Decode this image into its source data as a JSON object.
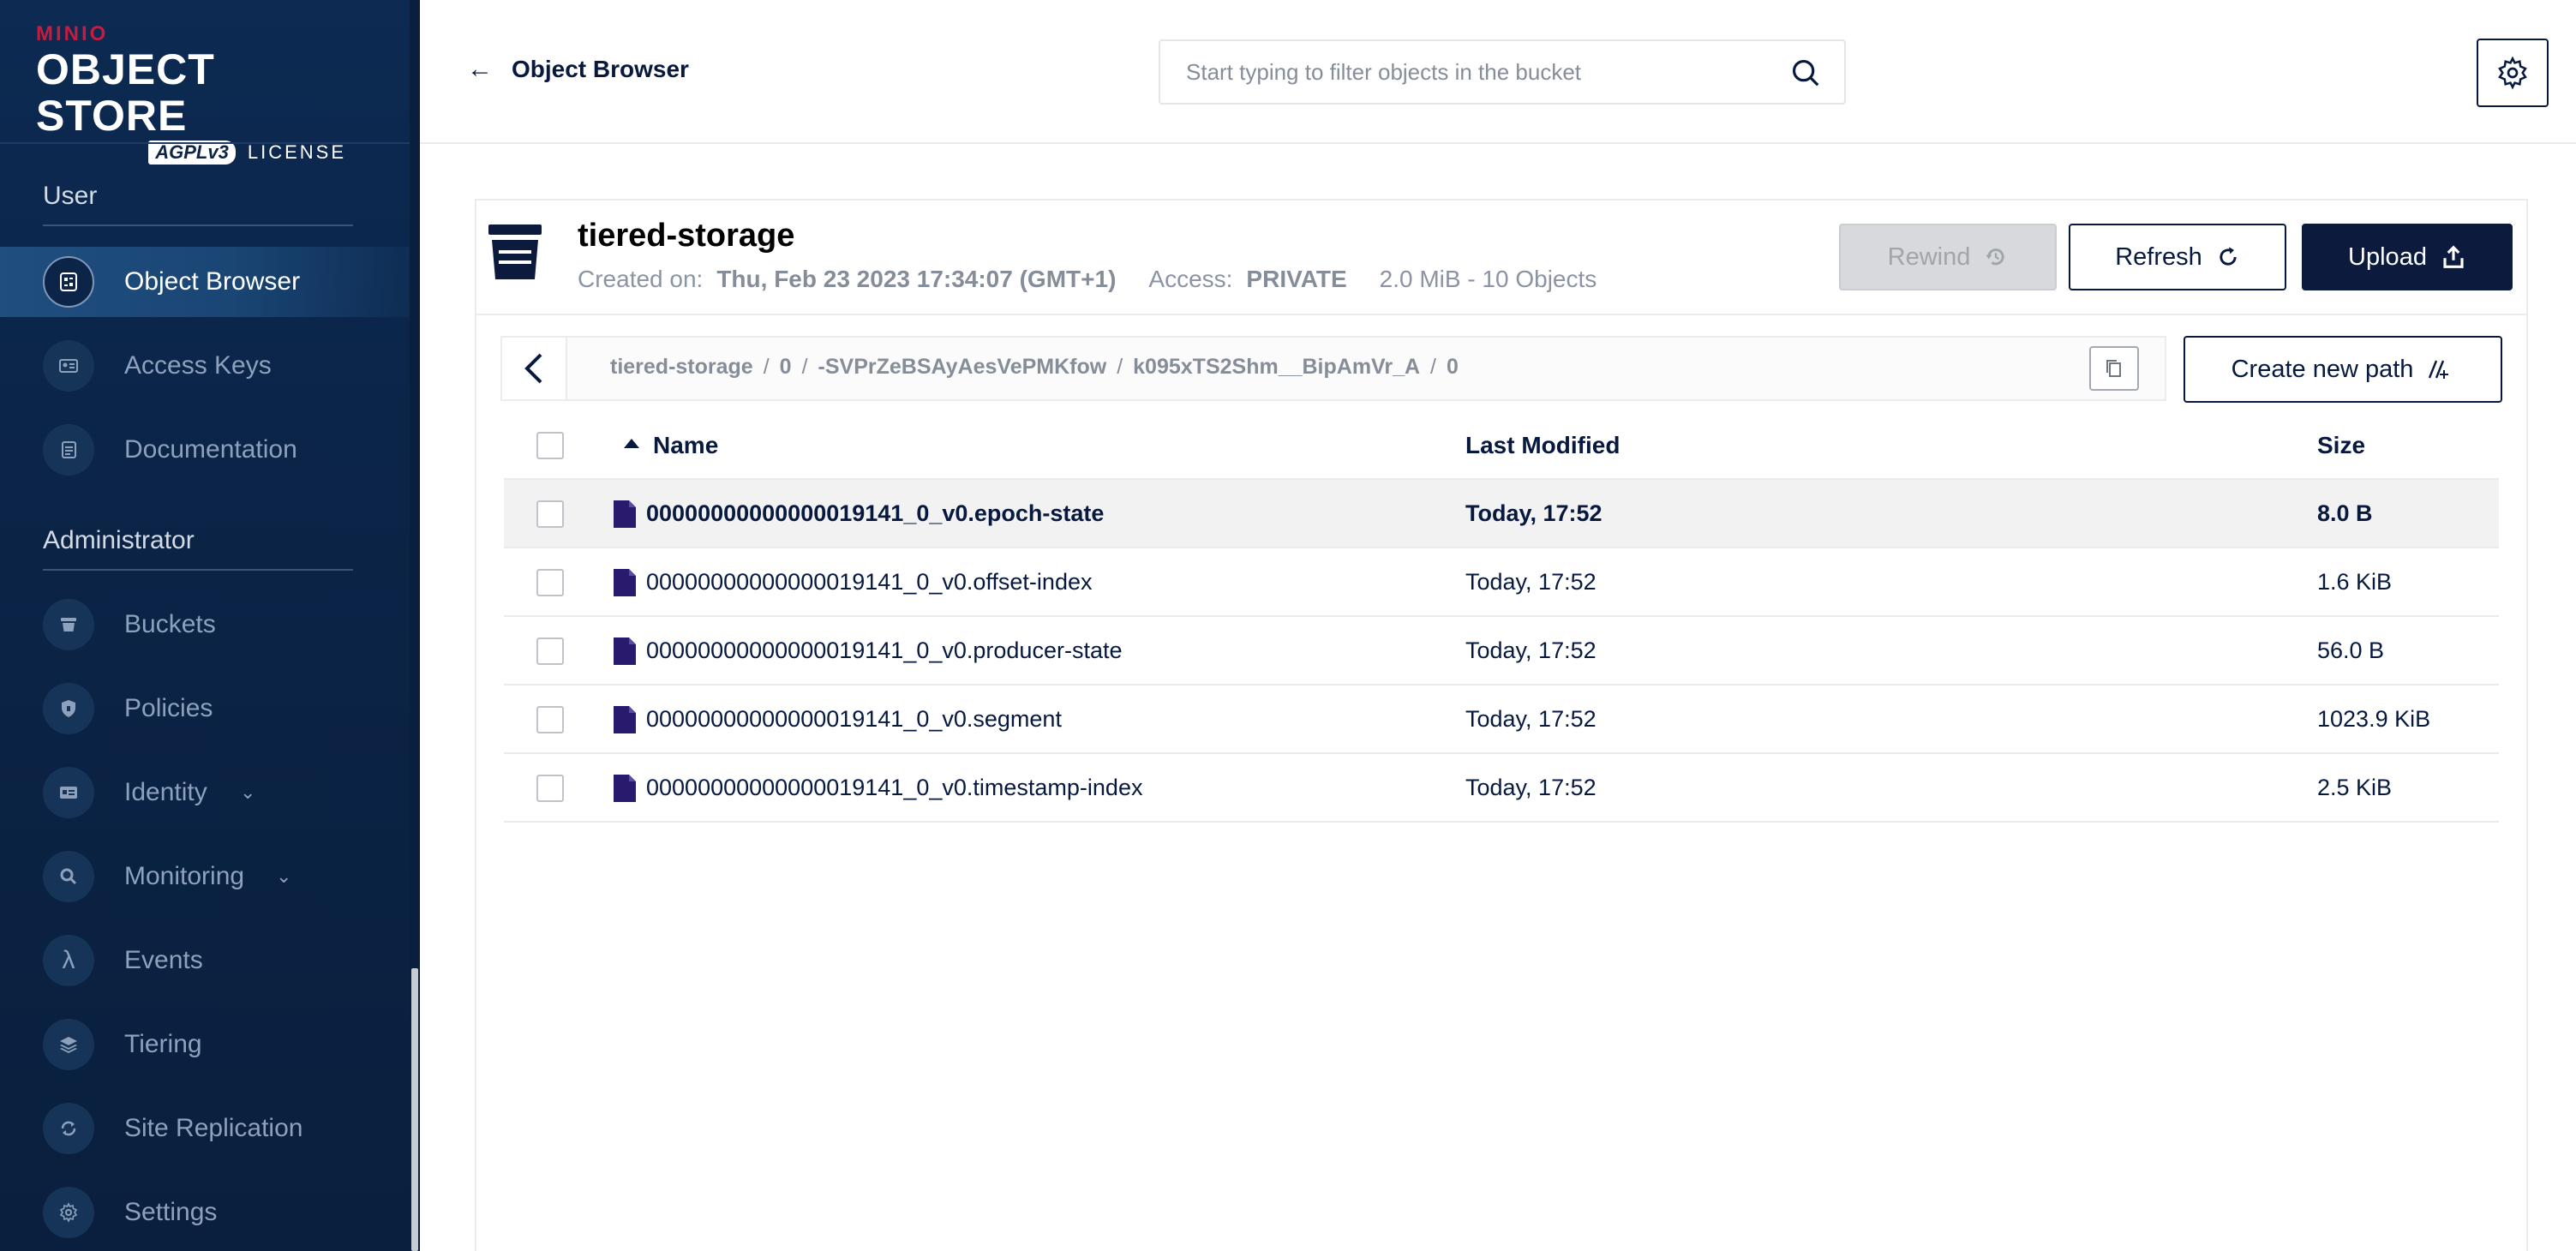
{
  "brand": {
    "minio": "MINIO",
    "title": "OBJECT STORE",
    "agpl": "AGPLv3",
    "license": "LICENSE"
  },
  "sidebar": {
    "user_section": "User",
    "admin_section": "Administrator",
    "user_items": [
      {
        "label": "Object Browser",
        "icon": "object-browser-icon",
        "active": true
      },
      {
        "label": "Access Keys",
        "icon": "access-keys-icon"
      },
      {
        "label": "Documentation",
        "icon": "documentation-icon"
      }
    ],
    "admin_items": [
      {
        "label": "Buckets",
        "icon": "bucket-icon"
      },
      {
        "label": "Policies",
        "icon": "shield-icon"
      },
      {
        "label": "Identity",
        "icon": "id-card-icon",
        "expandable": true
      },
      {
        "label": "Monitoring",
        "icon": "magnifier-icon",
        "expandable": true
      },
      {
        "label": "Events",
        "icon": "lambda-icon",
        "glyph": "λ"
      },
      {
        "label": "Tiering",
        "icon": "layers-icon"
      },
      {
        "label": "Site Replication",
        "icon": "sync-icon"
      },
      {
        "label": "Settings",
        "icon": "gear-icon"
      }
    ]
  },
  "header": {
    "back_label": "Object Browser",
    "search_placeholder": "Start typing to filter objects in the bucket"
  },
  "bucket": {
    "name": "tiered-storage",
    "created_label": "Created on:",
    "created_value": "Thu, Feb 23 2023 17:34:07 (GMT+1)",
    "access_label": "Access:",
    "access_value": "PRIVATE",
    "usage": "2.0 MiB - 10 Objects"
  },
  "actions": {
    "rewind": "Rewind",
    "refresh": "Refresh",
    "upload": "Upload",
    "create_path": "Create new path"
  },
  "breadcrumb": {
    "parts": [
      "tiered-storage",
      "0",
      "-SVPrZeBSAyAesVePMKfow",
      "k095xTS2Shm__BipAmVr_A",
      "0"
    ]
  },
  "table": {
    "columns": {
      "name": "Name",
      "modified": "Last Modified",
      "size": "Size"
    },
    "rows": [
      {
        "name": "00000000000000019141_0_v0.epoch-state",
        "modified": "Today, 17:52",
        "size": "8.0 B",
        "selected": true
      },
      {
        "name": "00000000000000019141_0_v0.offset-index",
        "modified": "Today, 17:52",
        "size": "1.6 KiB"
      },
      {
        "name": "00000000000000019141_0_v0.producer-state",
        "modified": "Today, 17:52",
        "size": "56.0 B"
      },
      {
        "name": "00000000000000019141_0_v0.segment",
        "modified": "Today, 17:52",
        "size": "1023.9 KiB"
      },
      {
        "name": "00000000000000019141_0_v0.timestamp-index",
        "modified": "Today, 17:52",
        "size": "2.5 KiB"
      }
    ]
  },
  "colors": {
    "sidebar_bg": "#0b2447",
    "accent_dark": "#0c1b3d",
    "minio_red": "#c51c3f",
    "file_icon": "#2a1a6e"
  }
}
